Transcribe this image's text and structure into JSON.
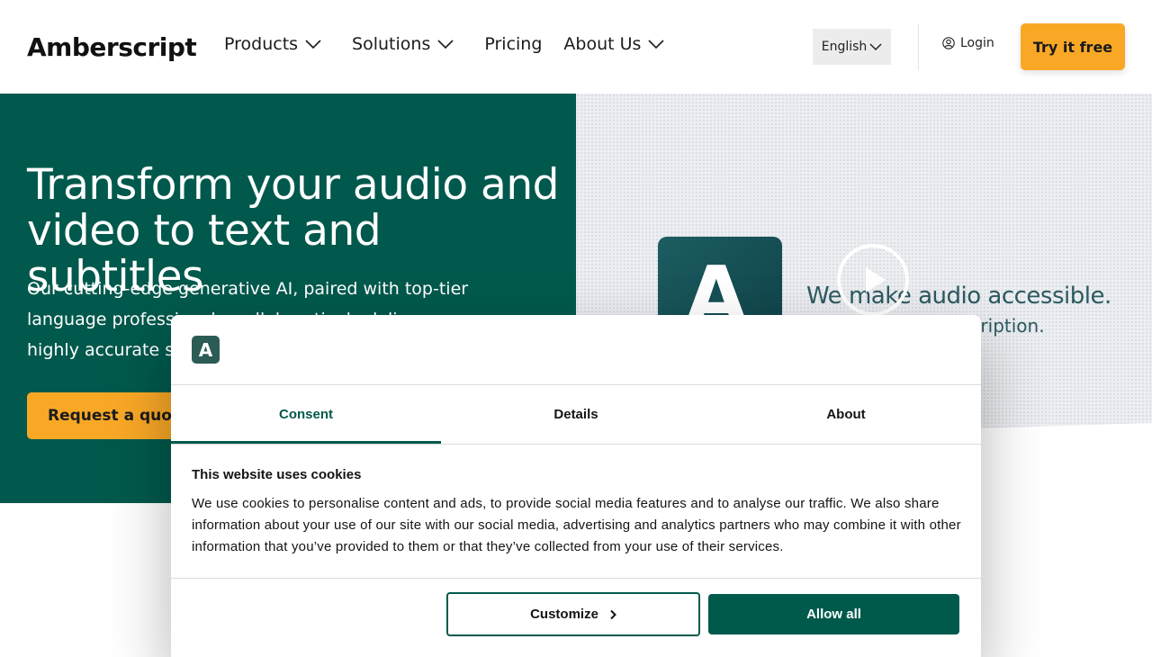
{
  "header": {
    "logo": "Amberscript",
    "nav": [
      {
        "label": "Products",
        "has_dropdown": true
      },
      {
        "label": "Solutions",
        "has_dropdown": true
      },
      {
        "label": "Pricing",
        "has_dropdown": false
      },
      {
        "label": "About Us",
        "has_dropdown": true
      }
    ],
    "language": "English",
    "login": "Login",
    "try_button": "Try it free"
  },
  "hero": {
    "title_line1": "Transform your audio and",
    "title_line2": "video to text and subtitles",
    "subtitle": "Our cutting-edge generative AI, paired with top-tier language professionals, collaboratively deliver highly accurate solutions",
    "quote_button": "Request a quote",
    "video": {
      "logo_mark": "A",
      "text1": "We make audio accessible.",
      "text2": "scription."
    }
  },
  "cookie_dialog": {
    "logo_mark": "A",
    "tabs": [
      {
        "label": "Consent",
        "active": true
      },
      {
        "label": "Details",
        "active": false
      },
      {
        "label": "About",
        "active": false
      }
    ],
    "heading": "This website uses cookies",
    "body": "We use cookies to personalise content and ads, to provide social media features and to analyse our traffic. We also share information about your use of our site with our social media, advertising and analytics partners who may combine it with other information that you’ve provided to them or that they’ve collected from your use of their services.",
    "customize_button": "Customize",
    "allow_button": "Allow all"
  },
  "colors": {
    "brand_green": "#00594c",
    "accent_orange": "#f9a826"
  }
}
